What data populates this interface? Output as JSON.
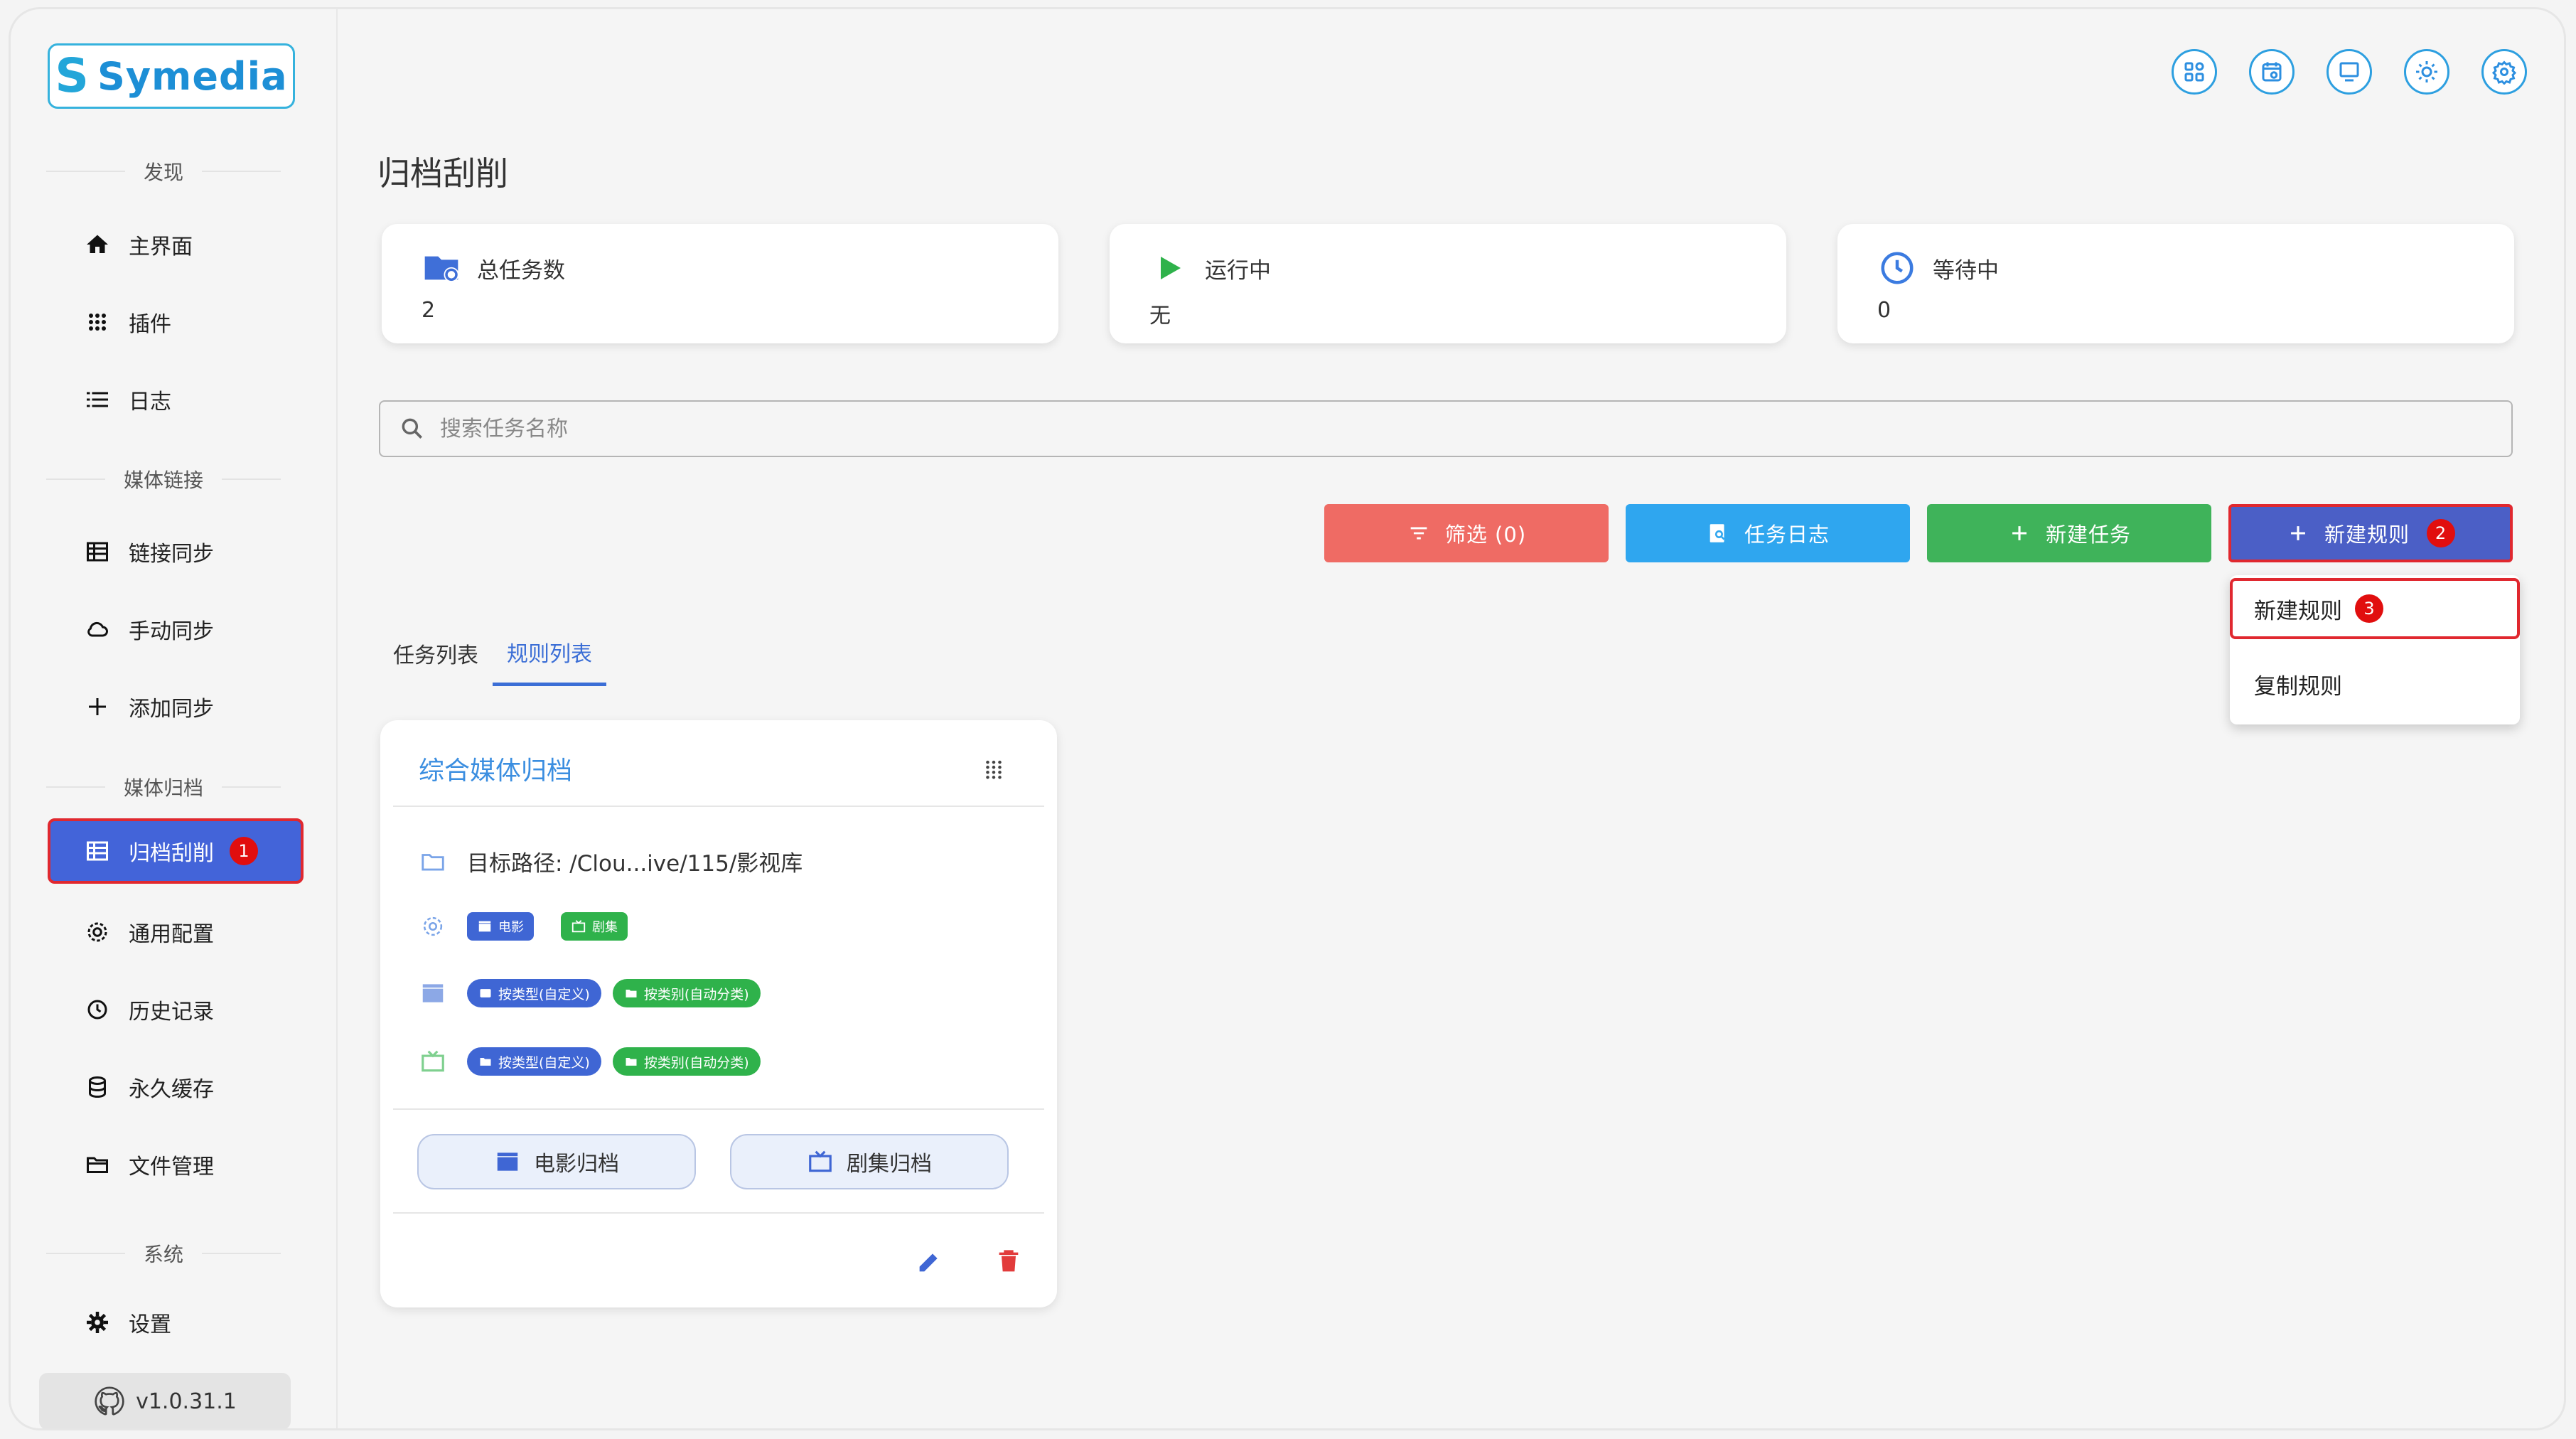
{
  "app": {
    "logo": "Symedia",
    "logo_mark": "S",
    "version": "v1.0.31.1"
  },
  "sidebar": {
    "sections": [
      "发现",
      "媒体链接",
      "媒体归档",
      "系统"
    ],
    "items": [
      {
        "label": "主界面",
        "icon": "home-icon"
      },
      {
        "label": "插件",
        "icon": "apps-icon"
      },
      {
        "label": "日志",
        "icon": "list-icon"
      },
      {
        "label": "链接同步",
        "icon": "table-icon"
      },
      {
        "label": "手动同步",
        "icon": "cloud-sync-icon"
      },
      {
        "label": "添加同步",
        "icon": "plus-icon"
      },
      {
        "label": "归档刮削",
        "icon": "table-icon",
        "active": true,
        "badge": "1"
      },
      {
        "label": "通用配置",
        "icon": "gear-icon"
      },
      {
        "label": "历史记录",
        "icon": "history-icon"
      },
      {
        "label": "永久缓存",
        "icon": "database-icon"
      },
      {
        "label": "文件管理",
        "icon": "folder-open-icon"
      },
      {
        "label": "设置",
        "icon": "settings-icon"
      }
    ]
  },
  "topbar": {
    "icons": [
      "widgets-icon",
      "calendar-icon",
      "monitor-icon",
      "sun-icon",
      "settings-icon"
    ]
  },
  "page": {
    "title": "归档刮削"
  },
  "stats": [
    {
      "label": "总任务数",
      "value": "2",
      "icon": "folder-sync-icon",
      "color": "#3f6fd8"
    },
    {
      "label": "运行中",
      "value": "无",
      "icon": "play-icon",
      "color": "#2fb24b"
    },
    {
      "label": "等待中",
      "value": "0",
      "icon": "clock-icon",
      "color": "#3b7be0"
    }
  ],
  "search": {
    "placeholder": "搜索任务名称"
  },
  "actions": {
    "filter_label": "筛选 (0)",
    "log_label": "任务日志",
    "new_task_label": "新建任务",
    "new_rule_label": "新建规则",
    "new_rule_badge": "2",
    "colors": {
      "filter": "#ef6b64",
      "log": "#2fa6ef",
      "new_task": "#3fb35a",
      "new_rule": "#4b5fc6"
    }
  },
  "tabs": [
    {
      "label": "任务列表"
    },
    {
      "label": "规则列表",
      "active": true
    }
  ],
  "dropdown": {
    "items": [
      {
        "label": "新建规则",
        "badge": "3"
      },
      {
        "label": "复制规则"
      }
    ]
  },
  "rule_card": {
    "title": "综合媒体归档",
    "target_path": "目标路径: /Clou...ive/115/影视库",
    "media_types": [
      "电影",
      "剧集"
    ],
    "movie_tags": [
      "按类型(自定义)",
      "按类别(自动分类)"
    ],
    "tv_tags": [
      "按类型(自定义)",
      "按类别(自动分类)"
    ],
    "buttons": {
      "movie": "电影归档",
      "tv": "剧集归档"
    }
  }
}
